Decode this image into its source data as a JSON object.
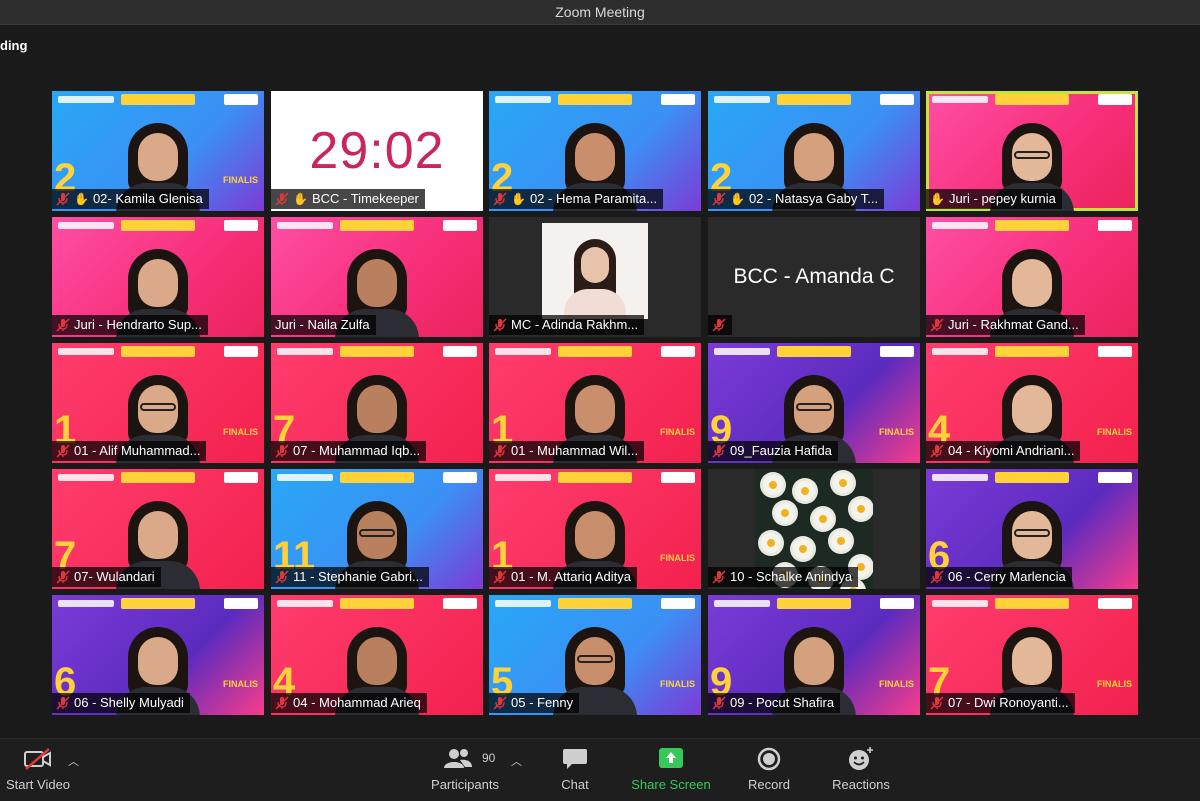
{
  "window": {
    "title": "Zoom Meeting",
    "recording_label": "ding"
  },
  "tiles": [
    {
      "name": "02- Kamila Glenisa",
      "number": "2",
      "finalis": "FINALIS",
      "hand": true,
      "muted": true
    },
    {
      "name": "BCC - Timekeeper",
      "timer": "29:02",
      "hand": true,
      "muted": true
    },
    {
      "name": "02 - Hema Paramita...",
      "number": "2",
      "hand": true,
      "muted": true
    },
    {
      "name": "02 - Natasya Gaby T...",
      "number": "2",
      "hand": true,
      "muted": true
    },
    {
      "name": "Juri - pepey kurnia",
      "hand": true,
      "muted": false,
      "active": true
    },
    {
      "name": "Juri - Hendrarto Sup...",
      "muted": true
    },
    {
      "name": "Juri - Naila Zulfa",
      "muted": false
    },
    {
      "name": "MC - Adinda Rakhm...",
      "muted": true
    },
    {
      "name": "",
      "big_name": "BCC - Amanda C",
      "muted": true
    },
    {
      "name": "Juri - Rakhmat Gand...",
      "muted": true
    },
    {
      "name": "01 - Alif Muhammad...",
      "number": "1",
      "finalis": "FINALIS",
      "muted": true
    },
    {
      "name": "07 - Muhammad Iqb...",
      "number": "7",
      "muted": true
    },
    {
      "name": "01 - Muhammad Wil...",
      "number": "1",
      "finalis": "FINALIS",
      "muted": true
    },
    {
      "name": "09_Fauzia Hafida",
      "number": "9",
      "finalis": "FINALIS",
      "muted": true
    },
    {
      "name": "04 - Kiyomi Andriani...",
      "number": "4",
      "finalis": "FINALIS",
      "muted": true
    },
    {
      "name": "07- Wulandari",
      "number": "7",
      "muted": true
    },
    {
      "name": "11 - Stephanie Gabri...",
      "number": "11",
      "muted": true
    },
    {
      "name": "01 - M. Attariq Aditya",
      "number": "1",
      "finalis": "FINALIS",
      "muted": true
    },
    {
      "name": "10 - Schalke Anindya",
      "muted": true
    },
    {
      "name": "06 - Cerry Marlencia",
      "number": "6",
      "muted": true
    },
    {
      "name": "06 - Shelly Mulyadi",
      "number": "6",
      "finalis": "FINALIS",
      "muted": true
    },
    {
      "name": "04 - Mohammad Arieq",
      "number": "4",
      "muted": true
    },
    {
      "name": "05 - Fenny",
      "number": "5",
      "finalis": "FINALIS",
      "muted": true
    },
    {
      "name": "09 - Pocut Shafira",
      "number": "9",
      "finalis": "FINALIS",
      "muted": true
    },
    {
      "name": "07 - Dwi Ronoyanti...",
      "number": "7",
      "finalis": "FINALIS",
      "muted": true
    }
  ],
  "toolbar": {
    "start_video": "Start Video",
    "participants": "Participants",
    "participants_count": "90",
    "chat": "Chat",
    "share_screen": "Share Screen",
    "record": "Record",
    "reactions": "Reactions"
  },
  "colors": {
    "active_speaker": "#c7e33c",
    "share_green": "#38c85a",
    "timer": "#c9265a"
  }
}
